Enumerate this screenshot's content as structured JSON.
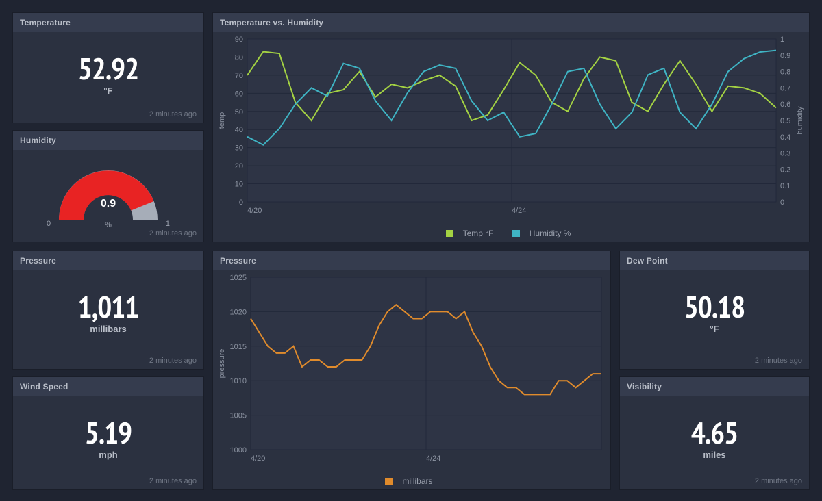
{
  "temperature": {
    "title": "Temperature",
    "value": "52.92",
    "unit": "°F",
    "timestamp": "2 minutes ago"
  },
  "humidity_gauge": {
    "title": "Humidity",
    "value": "0.9",
    "unit": "%",
    "min": "0",
    "max": "1",
    "timestamp": "2 minutes ago"
  },
  "pressure_stat": {
    "title": "Pressure",
    "value": "1,011",
    "unit": "millibars",
    "timestamp": "2 minutes ago"
  },
  "windspeed": {
    "title": "Wind Speed",
    "value": "5.19",
    "unit": "mph",
    "timestamp": "2 minutes ago"
  },
  "dewpoint": {
    "title": "Dew Point",
    "value": "50.18",
    "unit": "°F",
    "timestamp": "2 minutes ago"
  },
  "visibility": {
    "title": "Visibility",
    "value": "4.65",
    "unit": "miles",
    "timestamp": "2 minutes ago"
  },
  "temp_humidity_chart": {
    "title": "Temperature vs. Humidity",
    "ylabel_left": "temp",
    "ylabel_right": "humidity",
    "x_ticks": [
      "4/20",
      "4/24"
    ],
    "legend": {
      "a": "Temp °F",
      "b": "Humidity %"
    },
    "colors": {
      "temp": "#a4d243",
      "humidity": "#3fb4c4"
    }
  },
  "pressure_chart": {
    "title": "Pressure",
    "ylabel": "pressure",
    "x_ticks": [
      "4/20",
      "4/24"
    ],
    "legend": "millibars",
    "color": "#e08b2c"
  },
  "chart_data": [
    {
      "type": "line",
      "title": "Temperature vs. Humidity",
      "xlabel": "",
      "x_ticks": [
        "4/20",
        "4/24"
      ],
      "y_left": {
        "label": "temp",
        "range": [
          0,
          90
        ],
        "ticks": [
          0,
          10,
          20,
          30,
          40,
          50,
          60,
          70,
          80,
          90
        ]
      },
      "y_right": {
        "label": "humidity",
        "range": [
          0,
          1
        ],
        "ticks": [
          0,
          0.1,
          0.2,
          0.3,
          0.4,
          0.5,
          0.6,
          0.7,
          0.8,
          0.9,
          1
        ]
      },
      "series": [
        {
          "name": "Temp °F",
          "axis": "left",
          "color": "#a4d243",
          "values": [
            70,
            83,
            82,
            55,
            45,
            60,
            62,
            72,
            58,
            65,
            63,
            67,
            70,
            64,
            45,
            48,
            62,
            77,
            70,
            55,
            50,
            68,
            80,
            78,
            55,
            50,
            65,
            78,
            65,
            50,
            64,
            63,
            60,
            52
          ]
        },
        {
          "name": "Humidity %",
          "axis": "right",
          "color": "#3fb4c4",
          "values": [
            0.4,
            0.35,
            0.45,
            0.6,
            0.7,
            0.65,
            0.85,
            0.82,
            0.62,
            0.5,
            0.67,
            0.8,
            0.84,
            0.82,
            0.62,
            0.5,
            0.55,
            0.4,
            0.42,
            0.6,
            0.8,
            0.82,
            0.6,
            0.45,
            0.55,
            0.78,
            0.82,
            0.55,
            0.45,
            0.6,
            0.8,
            0.88,
            0.92,
            0.93
          ]
        }
      ]
    },
    {
      "type": "line",
      "title": "Pressure",
      "xlabel": "",
      "x_ticks": [
        "4/20",
        "4/24"
      ],
      "y": {
        "label": "pressure",
        "range": [
          1000,
          1025
        ],
        "ticks": [
          1000,
          1005,
          1010,
          1015,
          1020,
          1025
        ]
      },
      "series": [
        {
          "name": "millibars",
          "color": "#e08b2c",
          "values": [
            1019,
            1017,
            1015,
            1014,
            1014,
            1015,
            1012,
            1013,
            1013,
            1012,
            1012,
            1013,
            1013,
            1013,
            1015,
            1018,
            1020,
            1021,
            1020,
            1019,
            1019,
            1020,
            1020,
            1020,
            1019,
            1020,
            1017,
            1015,
            1012,
            1010,
            1009,
            1009,
            1008,
            1008,
            1008,
            1008,
            1010,
            1010,
            1009,
            1010,
            1011,
            1011
          ]
        }
      ]
    }
  ]
}
